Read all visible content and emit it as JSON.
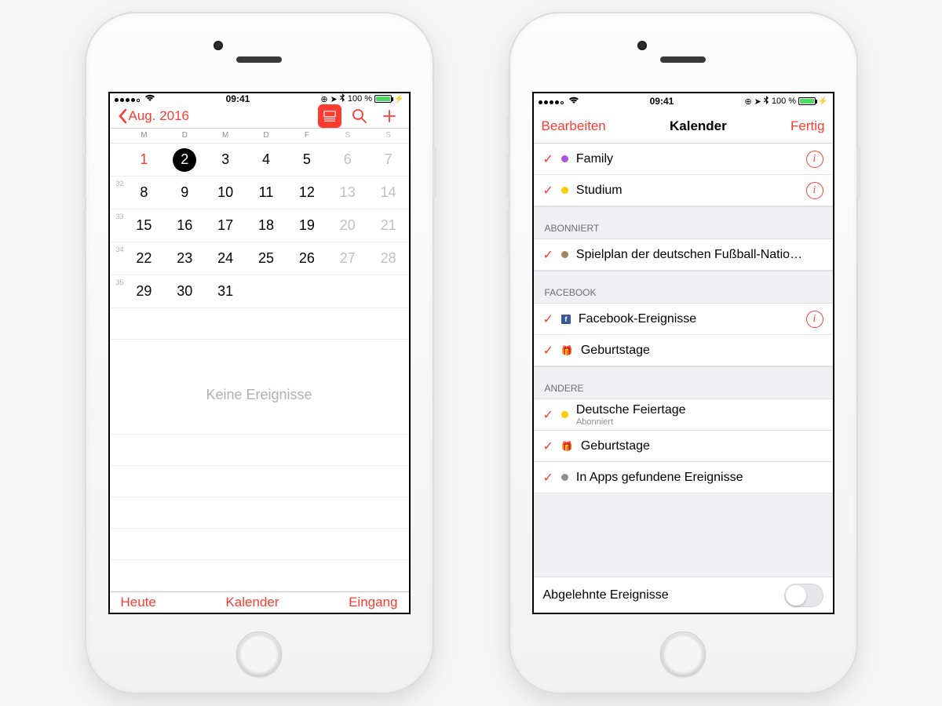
{
  "status": {
    "time": "09:41",
    "battery_pct": "100 %"
  },
  "left": {
    "back_label": "Aug. 2016",
    "weekdays": [
      "M",
      "D",
      "M",
      "D",
      "F",
      "S",
      "S"
    ],
    "weeks": [
      {
        "num": "",
        "days": [
          "1",
          "2",
          "3",
          "4",
          "5",
          "6",
          "7"
        ]
      },
      {
        "num": "32",
        "days": [
          "8",
          "9",
          "10",
          "11",
          "12",
          "13",
          "14"
        ]
      },
      {
        "num": "33",
        "days": [
          "15",
          "16",
          "17",
          "18",
          "19",
          "20",
          "21"
        ]
      },
      {
        "num": "34",
        "days": [
          "22",
          "23",
          "24",
          "25",
          "26",
          "27",
          "28"
        ]
      },
      {
        "num": "35",
        "days": [
          "29",
          "30",
          "31",
          "",
          "",
          "",
          ""
        ]
      }
    ],
    "selected_day": "2",
    "empty_label": "Keine Ereignisse",
    "toolbar": {
      "today": "Heute",
      "calendars": "Kalender",
      "inbox": "Eingang"
    }
  },
  "right": {
    "nav": {
      "edit": "Bearbeiten",
      "title": "Kalender",
      "done": "Fertig"
    },
    "top_items": [
      {
        "label": "Family",
        "color": "#af52de",
        "info": true
      },
      {
        "label": "Studium",
        "color": "#ffcc00",
        "info": true
      }
    ],
    "sections": [
      {
        "header": "ABONNIERT",
        "items": [
          {
            "label": "Spielplan der deutschen Fußball-Natio…",
            "color": "#a2845e",
            "info": false
          }
        ]
      },
      {
        "header": "FACEBOOK",
        "items": [
          {
            "label": "Facebook-Ereignisse",
            "icon": "fb",
            "info": true
          },
          {
            "label": "Geburtstage",
            "icon": "gift",
            "info": false
          }
        ]
      },
      {
        "header": "ANDERE",
        "items": [
          {
            "label": "Deutsche Feiertage",
            "sub": "Abonniert",
            "color": "#ffcc00",
            "info": false
          },
          {
            "label": "Geburtstage",
            "icon": "gift",
            "info": false
          },
          {
            "label": "In Apps gefundene Ereignisse",
            "color": "#8e8e93",
            "info": false
          }
        ]
      }
    ],
    "declined_label": "Abgelehnte Ereignisse"
  }
}
